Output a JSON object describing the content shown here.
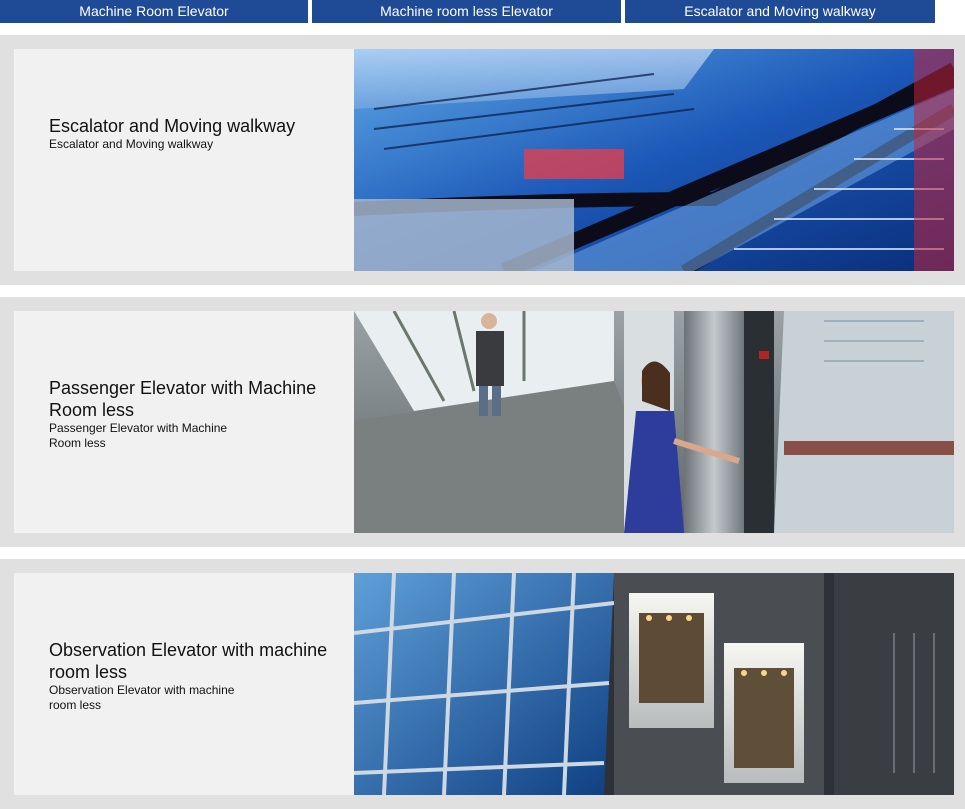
{
  "tabs": [
    {
      "label": "Machine Room Elevator"
    },
    {
      "label": "Machine room less Elevator"
    },
    {
      "label": "Escalator and Moving walkway"
    }
  ],
  "cards": [
    {
      "title": "Escalator and Moving walkway",
      "subtitle": "Escalator and Moving walkway",
      "image": "escalator-photo"
    },
    {
      "title": "Passenger Elevator with Machine Room less",
      "subtitle": "Passenger Elevator with Machine Room less",
      "image": "passenger-elevator-photo"
    },
    {
      "title": "Observation Elevator with machine room less",
      "subtitle": "Observation Elevator with machine room less",
      "image": "observation-elevator-photo"
    }
  ],
  "colors": {
    "tab_bg": "#1f4a96",
    "card_bg": "#e0e0e0",
    "panel_bg": "#f1f1f1"
  }
}
